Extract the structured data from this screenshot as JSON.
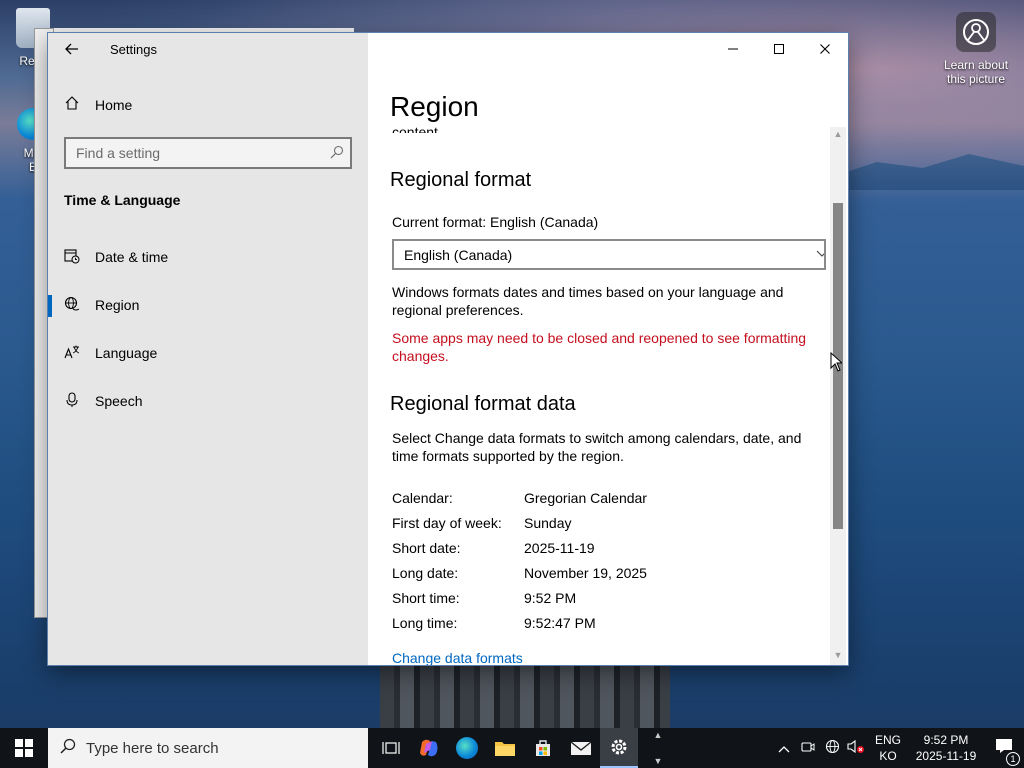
{
  "desktop": {
    "icons": [
      {
        "name": "recycle-bin",
        "label": "Recy"
      },
      {
        "name": "edge",
        "label": "Mic\nE"
      }
    ],
    "learn_about": "Learn about this picture"
  },
  "window": {
    "title": "Settings",
    "nav": {
      "home": "Home",
      "search_placeholder": "Find a setting",
      "section_title": "Time & Language",
      "items": [
        {
          "label": "Date & time",
          "icon": "calendar-clock-icon"
        },
        {
          "label": "Region",
          "icon": "globe-icon",
          "active": true
        },
        {
          "label": "Language",
          "icon": "language-icon"
        },
        {
          "label": "Speech",
          "icon": "microphone-icon"
        }
      ]
    },
    "content": {
      "page_title": "Region",
      "cut_text": "content.",
      "regional_format": {
        "heading": "Regional format",
        "current_format": "Current format: English (Canada)",
        "selected": "English (Canada)",
        "description": "Windows formats dates and times based on your language and regional preferences.",
        "warning": "Some apps may need to be closed and reopened to see formatting changes."
      },
      "format_data": {
        "heading": "Regional format data",
        "description": "Select Change data formats to switch among calendars, date, and time formats supported by the region.",
        "rows": [
          {
            "key": "Calendar:",
            "value": "Gregorian Calendar"
          },
          {
            "key": "First day of week:",
            "value": "Sunday"
          },
          {
            "key": "Short date:",
            "value": "2025-11-19"
          },
          {
            "key": "Long date:",
            "value": "November 19, 2025"
          },
          {
            "key": "Short time:",
            "value": "9:52 PM"
          },
          {
            "key": "Long time:",
            "value": "9:52:47 PM"
          }
        ],
        "change_link": "Change data formats"
      }
    }
  },
  "taskbar": {
    "search_placeholder": "Type here to search",
    "lang_top": "ENG",
    "lang_bottom": "KO",
    "time": "9:52 PM",
    "date": "2025-11-19",
    "notification_count": "1"
  }
}
